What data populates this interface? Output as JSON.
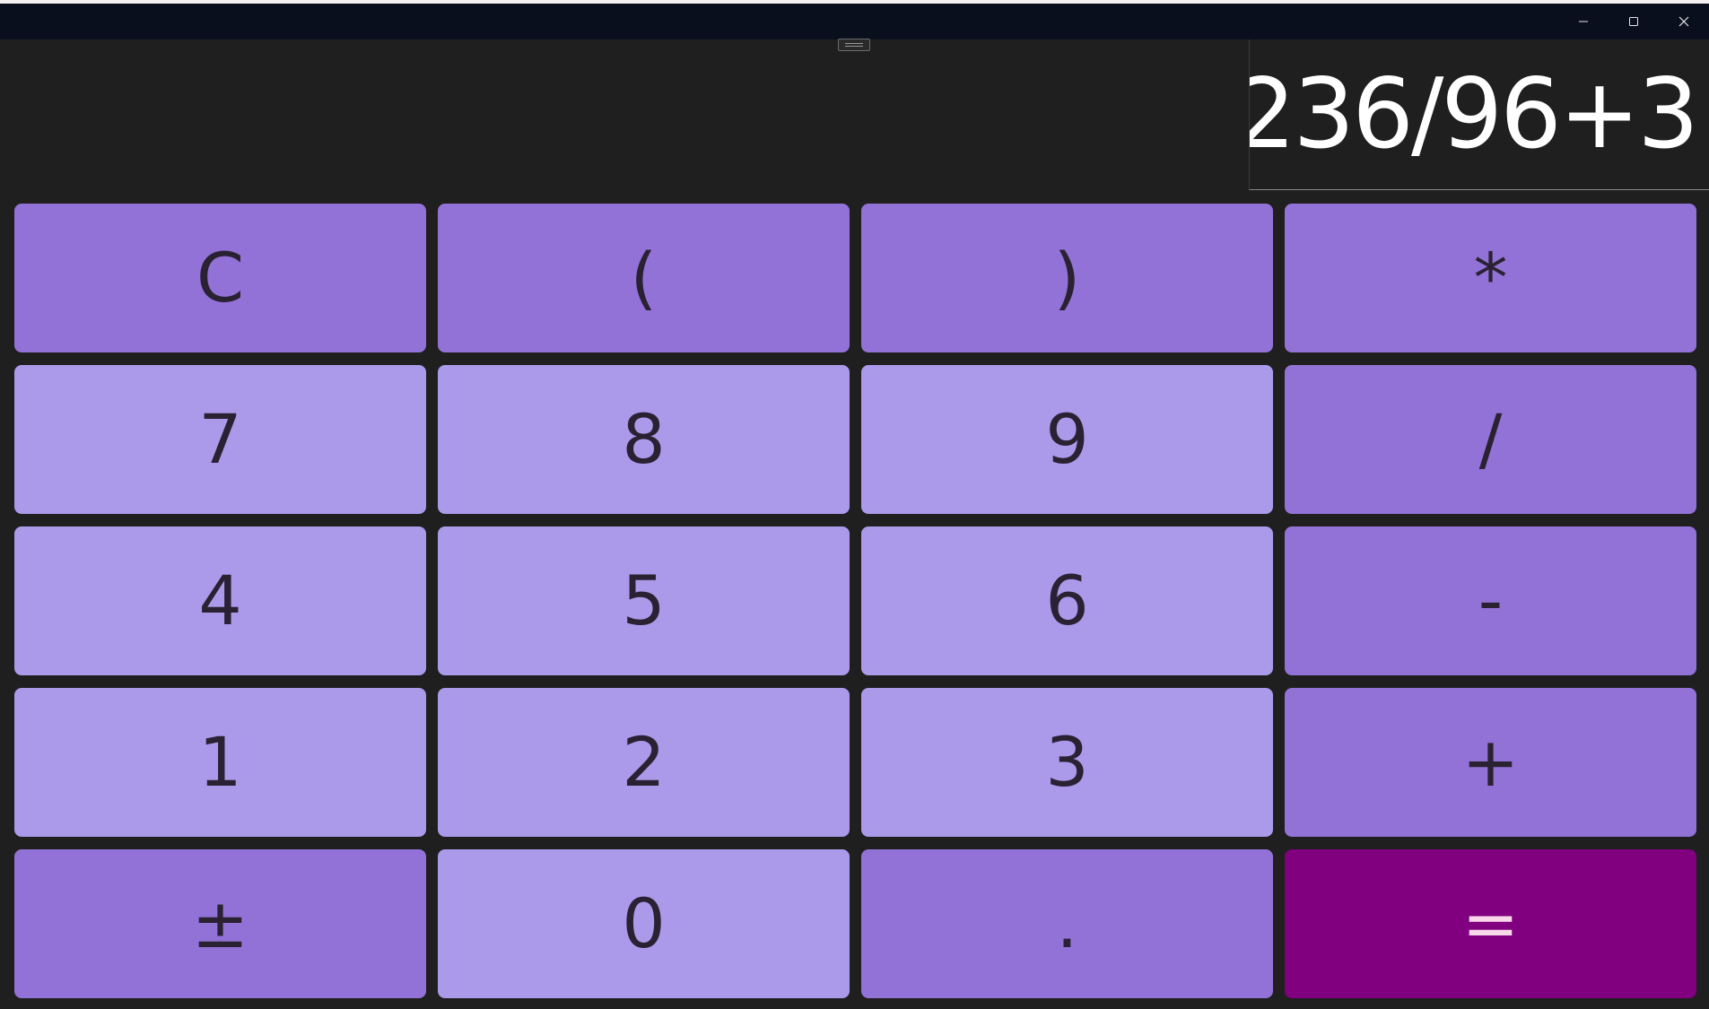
{
  "window": {
    "controls": {
      "minimize_icon": "minimize-icon",
      "maximize_icon": "maximize-icon",
      "close_icon": "close-icon"
    }
  },
  "display": {
    "expression": "236/96+3"
  },
  "keys": [
    {
      "label": "C",
      "kind": "op"
    },
    {
      "label": "(",
      "kind": "op"
    },
    {
      "label": ")",
      "kind": "op"
    },
    {
      "label": "*",
      "kind": "op"
    },
    {
      "label": "7",
      "kind": "num"
    },
    {
      "label": "8",
      "kind": "num"
    },
    {
      "label": "9",
      "kind": "num"
    },
    {
      "label": "/",
      "kind": "op"
    },
    {
      "label": "4",
      "kind": "num"
    },
    {
      "label": "5",
      "kind": "num"
    },
    {
      "label": "6",
      "kind": "num"
    },
    {
      "label": "-",
      "kind": "op"
    },
    {
      "label": "1",
      "kind": "num"
    },
    {
      "label": "2",
      "kind": "num"
    },
    {
      "label": "3",
      "kind": "num"
    },
    {
      "label": "+",
      "kind": "op"
    },
    {
      "label": "±",
      "kind": "op"
    },
    {
      "label": "0",
      "kind": "num"
    },
    {
      "label": ".",
      "kind": "op"
    },
    {
      "label": "=",
      "kind": "eq"
    }
  ],
  "colors": {
    "window_background": "#1f1f1f",
    "titlebar": "#0a0f1e",
    "operator_key": "#9272d6",
    "number_key": "#ab9aea",
    "equals_key": "#800080",
    "key_text": "#2a2233",
    "display_text": "#ffffff"
  }
}
